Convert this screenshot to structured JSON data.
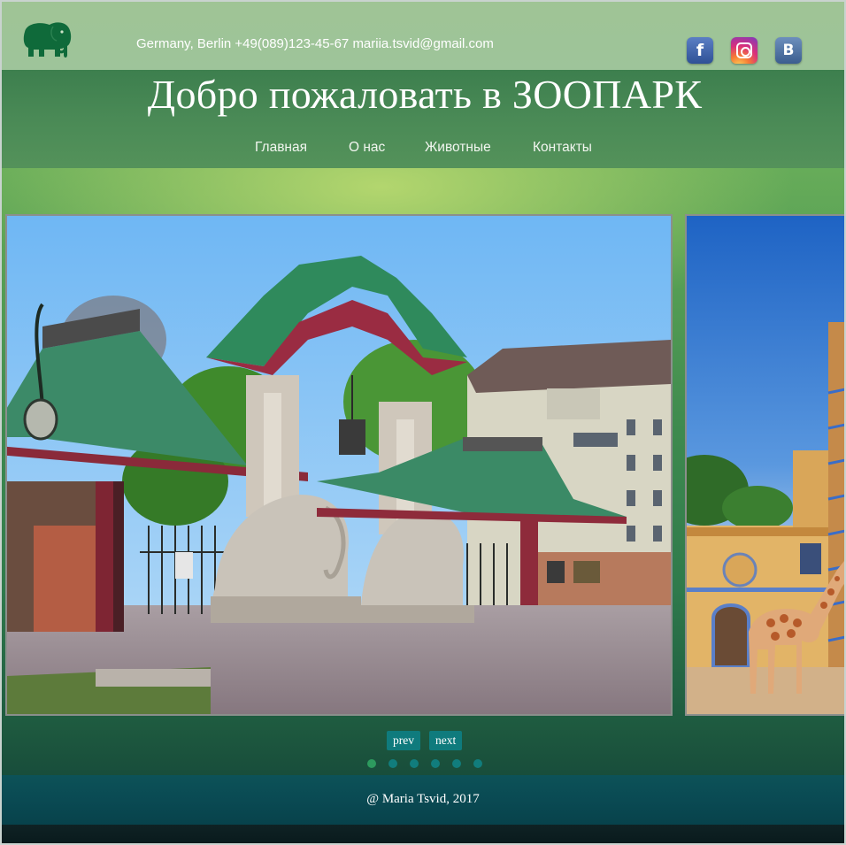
{
  "header": {
    "contact": "Germany, Berlin +49(089)123-45-67 mariia.tsvid@gmail.com",
    "title": "Добро пожаловать в ЗООПАРК",
    "logo_icon": "elephant-icon",
    "social": [
      {
        "name": "facebook-icon",
        "glyph": "f"
      },
      {
        "name": "instagram-icon",
        "glyph": ""
      },
      {
        "name": "vk-icon",
        "glyph": "B"
      }
    ]
  },
  "nav": {
    "items": [
      {
        "label": "Главная"
      },
      {
        "label": "О нас"
      },
      {
        "label": "Животные"
      },
      {
        "label": "Контакты"
      }
    ]
  },
  "slider": {
    "slides": [
      {
        "subject": "zoo-entrance-elephant-gate-photo"
      },
      {
        "subject": "giraffe-house-photo"
      }
    ],
    "prev_label": "prev",
    "next_label": "next",
    "dots_count": 6,
    "active_dot": 0
  },
  "footer": {
    "copyright": "@ Maria Tsvid, 2017"
  },
  "colors": {
    "accent_button": "#0f7b7d",
    "dot": "#117d7d",
    "dot_active": "#2d9a5e",
    "footer": "#0a4a53"
  }
}
